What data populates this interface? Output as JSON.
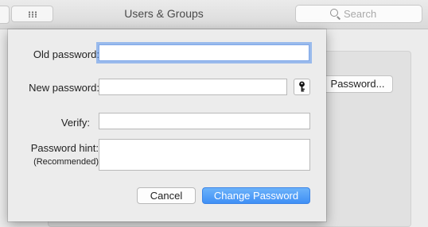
{
  "window": {
    "title": "Users & Groups",
    "search_placeholder": "Search",
    "password_button_label": "Password..."
  },
  "dialog": {
    "old_password_label": "Old password:",
    "new_password_label": "New password:",
    "verify_label": "Verify:",
    "hint_label": "Password hint:",
    "hint_sublabel": "(Recommended)",
    "old_password_value": "",
    "new_password_value": "",
    "verify_value": "",
    "hint_value": "",
    "cancel_label": "Cancel",
    "submit_label": "Change Password"
  },
  "colors": {
    "accent": "#3f8ff5",
    "focus_ring": "#5692ec"
  },
  "icons": {
    "key": "key-icon",
    "search": "search-icon",
    "grid": "grid-icon"
  }
}
